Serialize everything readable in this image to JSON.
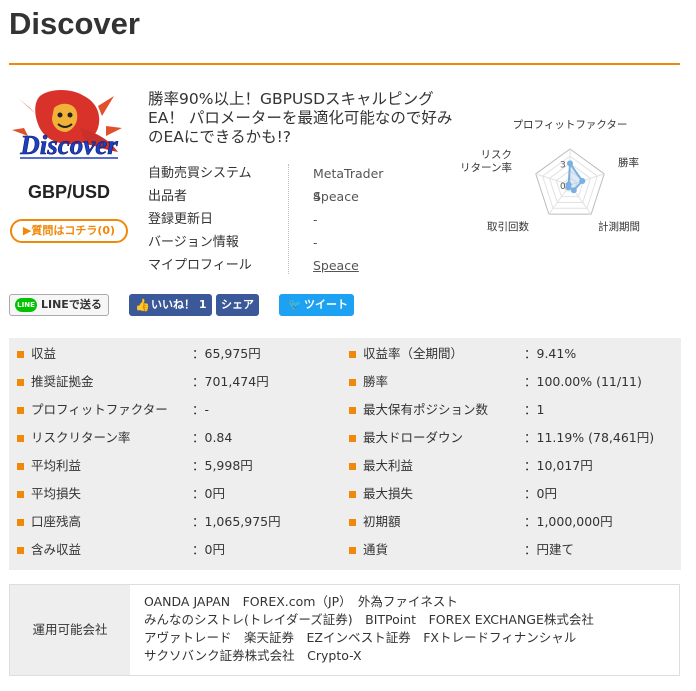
{
  "page": {
    "title": "Discover"
  },
  "logo": {
    "line1": "Discover",
    "line2": "GBP/USD"
  },
  "question_button": "▶質問はコチラ(0)",
  "ea": {
    "title": "勝率90%以上！GBPUSDスキャルピングEA！ パロメーターを最適化可能なので好みのEAにできるかも!?",
    "info": [
      {
        "label": "自動売買システム",
        "value": "MetaTrader 4"
      },
      {
        "label": "出品者",
        "value": "Speace"
      },
      {
        "label": "登録更新日",
        "value": "-"
      },
      {
        "label": "バージョン情報",
        "value": "-"
      },
      {
        "label": "マイプロフィール",
        "value": "Speace"
      }
    ]
  },
  "radar": {
    "axes": [
      "プロフィットファクター",
      "勝率",
      "計測期間",
      "取引回数",
      "リスクリターン率"
    ],
    "tick_labels": [
      "3",
      "0"
    ],
    "max": 5,
    "values": [
      3.0,
      1.8,
      0.9,
      0.4,
      0.2
    ],
    "color": "#7ab0e0"
  },
  "social": {
    "line": "LINEで送る",
    "like": "いいね！ 1",
    "share": "シェア",
    "tweet": "ツイート"
  },
  "stats": {
    "left": [
      {
        "label": "収益",
        "value": "：65,975円"
      },
      {
        "label": "推奨証拠金",
        "value": "：701,474円"
      },
      {
        "label": "プロフィットファクター",
        "value": "：-"
      },
      {
        "label": "リスクリターン率",
        "value": "：0.84"
      },
      {
        "label": "平均利益",
        "value": "：5,998円"
      },
      {
        "label": "平均損失",
        "value": "：0円"
      },
      {
        "label": "口座残高",
        "value": "：1,065,975円"
      },
      {
        "label": "含み収益",
        "value": "：0円"
      }
    ],
    "right": [
      {
        "label": "収益率（全期間）",
        "value": "：9.41%"
      },
      {
        "label": "勝率",
        "value": "：100.00% (11/11)"
      },
      {
        "label": "最大保有ポジション数",
        "value": "：1"
      },
      {
        "label": "最大ドローダウン",
        "value": "：11.19% (78,461円)"
      },
      {
        "label": "最大利益",
        "value": "：10,017円"
      },
      {
        "label": "最大損失",
        "value": "：0円"
      },
      {
        "label": "初期額",
        "value": "：1,000,000円"
      },
      {
        "label": "通貨",
        "value": "：円建て"
      }
    ]
  },
  "brokers": {
    "label": "運用可能会社",
    "lines": [
      "OANDA JAPAN　FOREX.com（JP）　外為ファイネスト",
      "みんなのシストレ(トレイダーズ証券)　BITPoint　FOREX EXCHANGE株式会社",
      "アヴァトレード　楽天証券　EZインベスト証券　FXトレードフィナンシャル",
      "サクソバンク証券株式会社　Crypto-X"
    ]
  },
  "colors": {
    "accent": "#f0880a",
    "facebook": "#3b5998",
    "twitter": "#1da1f2"
  }
}
